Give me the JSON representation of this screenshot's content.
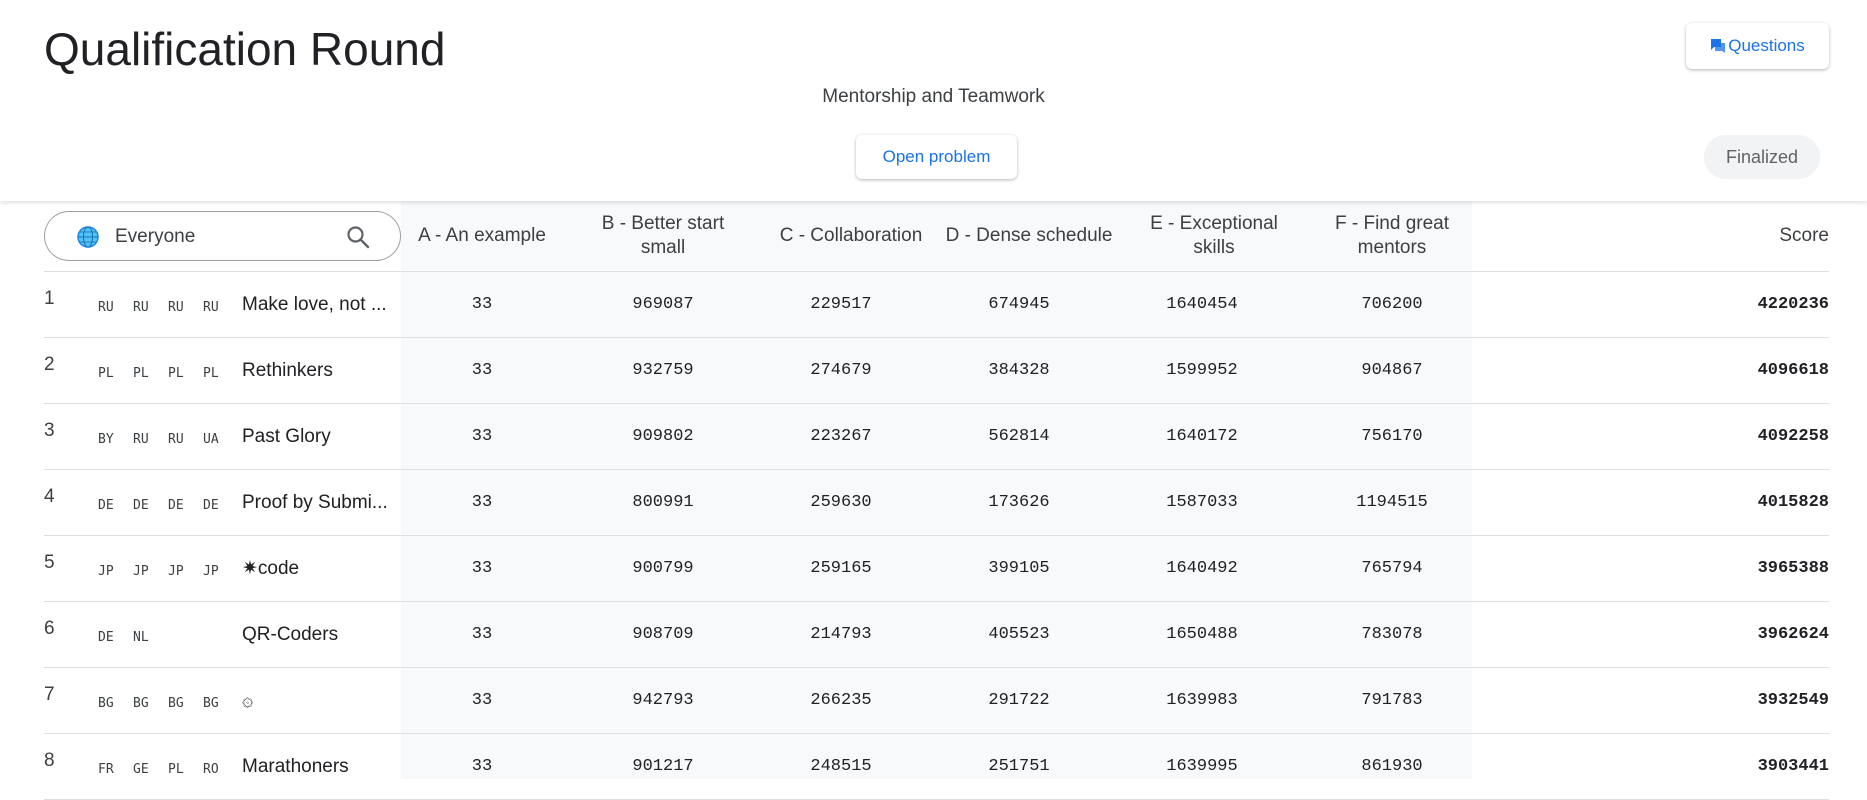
{
  "header": {
    "title": "Qualification Round",
    "subtitle": "Mentorship and Teamwork",
    "questions_label": "Questions",
    "open_problem_label": "Open problem",
    "status": "Finalized"
  },
  "search": {
    "value": "Everyone",
    "globe_icon": "globe-icon",
    "search_icon": "search-icon"
  },
  "columns": {
    "a": "A - An example",
    "b": "B - Better start small",
    "c": "C - Collaboration",
    "d": "D - Dense schedule",
    "e": "E - Exceptional skills",
    "f": "F - Find great mentors",
    "score": "Score"
  },
  "rows": [
    {
      "rank": "1",
      "flags": [
        "RU",
        "RU",
        "RU",
        "RU"
      ],
      "team": "Make love, not ...",
      "a": "33",
      "b": "969087",
      "c": "229517",
      "d": "674945",
      "e": "1640454",
      "f": "706200",
      "score": "4220236"
    },
    {
      "rank": "2",
      "flags": [
        "PL",
        "PL",
        "PL",
        "PL"
      ],
      "team": "Rethinkers",
      "a": "33",
      "b": "932759",
      "c": "274679",
      "d": "384328",
      "e": "1599952",
      "f": "904867",
      "score": "4096618"
    },
    {
      "rank": "3",
      "flags": [
        "BY",
        "RU",
        "RU",
        "UA"
      ],
      "team": "Past Glory",
      "a": "33",
      "b": "909802",
      "c": "223267",
      "d": "562814",
      "e": "1640172",
      "f": "756170",
      "score": "4092258"
    },
    {
      "rank": "4",
      "flags": [
        "DE",
        "DE",
        "DE",
        "DE"
      ],
      "team": "Proof by Submi...",
      "a": "33",
      "b": "800991",
      "c": "259630",
      "d": "173626",
      "e": "1587033",
      "f": "1194515",
      "score": "4015828"
    },
    {
      "rank": "5",
      "flags": [
        "JP",
        "JP",
        "JP",
        "JP"
      ],
      "team": "✷code",
      "a": "33",
      "b": "900799",
      "c": "259165",
      "d": "399105",
      "e": "1640492",
      "f": "765794",
      "score": "3965388"
    },
    {
      "rank": "6",
      "flags": [
        "DE",
        "NL",
        "",
        ""
      ],
      "team": "QR-Coders",
      "a": "33",
      "b": "908709",
      "c": "214793",
      "d": "405523",
      "e": "1650488",
      "f": "783078",
      "score": "3962624"
    },
    {
      "rank": "7",
      "flags": [
        "BG",
        "BG",
        "BG",
        "BG"
      ],
      "team": "۞",
      "a": "33",
      "b": "942793",
      "c": "266235",
      "d": "291722",
      "e": "1639983",
      "f": "791783",
      "score": "3932549"
    },
    {
      "rank": "8",
      "flags": [
        "FR",
        "GE",
        "PL",
        "RO"
      ],
      "team": "Marathoners",
      "a": "33",
      "b": "901217",
      "c": "248515",
      "d": "251751",
      "e": "1639995",
      "f": "861930",
      "score": "3903441"
    }
  ]
}
